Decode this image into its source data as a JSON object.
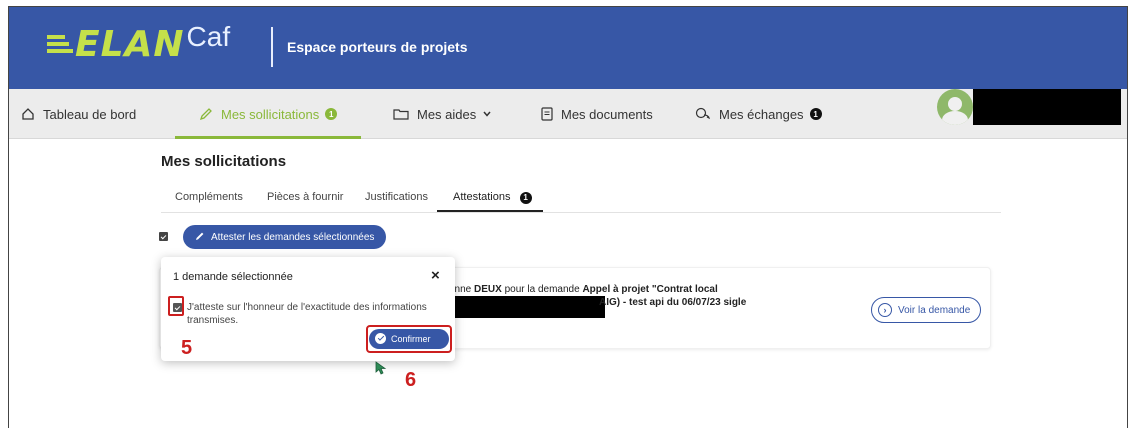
{
  "header": {
    "logo_elan": "ELAN",
    "logo_caf": "Caf",
    "title": "Espace porteurs de projets",
    "logo_color": "#c5e04a",
    "bg_color": "#3757a6"
  },
  "nav": {
    "items": [
      {
        "label": "Tableau de bord",
        "icon": "home-icon"
      },
      {
        "label": "Mes sollicitations",
        "icon": "pencil-icon",
        "badge": "1",
        "active": true
      },
      {
        "label": "Mes aides",
        "icon": "folder-icon",
        "dropdown": true
      },
      {
        "label": "Mes documents",
        "icon": "document-icon"
      },
      {
        "label": "Mes échanges",
        "icon": "chat-icon",
        "badge": "1"
      }
    ]
  },
  "main": {
    "title": "Mes sollicitations",
    "tabs": [
      {
        "label": "Compléments"
      },
      {
        "label": "Pièces à fournir"
      },
      {
        "label": "Justifications"
      },
      {
        "label": "Attestations",
        "badge": "1",
        "active": true
      }
    ],
    "attest_button": "Attester les demandes sélectionnées",
    "card": {
      "line1_prefix": "enne ",
      "line1_bold_name": "DEUX",
      "line1_mid": " pour la demande ",
      "line1_bold_type": "Appel à projet \"Contrat local",
      "line2": "AIG) - test api du 06/07/23 sigle",
      "view_button": "Voir la demande"
    }
  },
  "popup": {
    "title": "1 demande sélectionnée",
    "close": "×",
    "attest_text": "J'atteste sur l'honneur de l'exactitude des informations transmises.",
    "confirm": "Confirmer"
  },
  "annotations": {
    "step5": "5",
    "step6": "6",
    "color": "#cc1f1f"
  }
}
